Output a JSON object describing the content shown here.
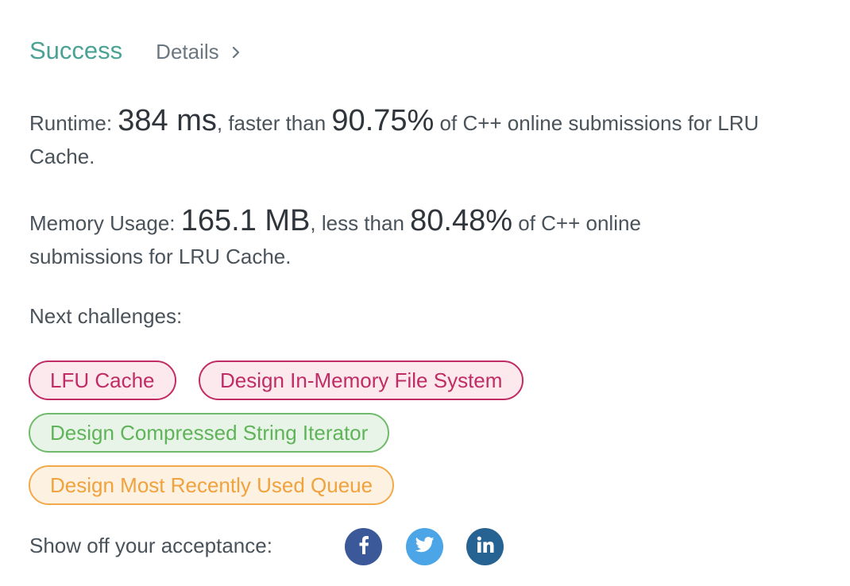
{
  "result": {
    "status": "Success",
    "details_label": "Details"
  },
  "runtime": {
    "label": "Runtime: ",
    "value": "384 ms",
    "comparison": ", faster than ",
    "percent": "90.75%",
    "suffix": " of C++ online submissions for LRU Cache."
  },
  "memory": {
    "label": "Memory Usage: ",
    "value": "165.1 MB",
    "comparison": ", less than ",
    "percent": "80.48%",
    "suffix": " of C++ online submissions for LRU Cache."
  },
  "next_challenges": {
    "label": "Next challenges:",
    "items": [
      {
        "title": "LFU Cache",
        "difficulty": "hard"
      },
      {
        "title": "Design In-Memory File System",
        "difficulty": "hard"
      },
      {
        "title": "Design Compressed String Iterator",
        "difficulty": "easy"
      },
      {
        "title": "Design Most Recently Used Queue",
        "difficulty": "medium"
      }
    ]
  },
  "share": {
    "label": "Show off your acceptance:",
    "networks": [
      {
        "name": "facebook",
        "color": "#3b5998"
      },
      {
        "name": "twitter",
        "color": "#4ba5e6"
      },
      {
        "name": "linkedin",
        "color": "#276392"
      }
    ]
  }
}
